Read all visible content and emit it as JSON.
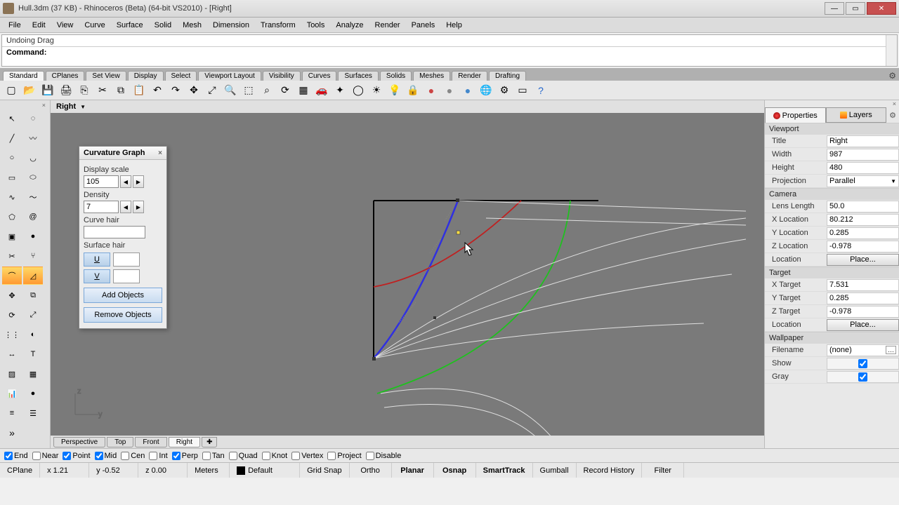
{
  "window": {
    "title": "Hull.3dm (37 KB) - Rhinoceros (Beta) (64-bit VS2010) - [Right]",
    "btn_min": "—",
    "btn_max": "▭",
    "btn_close": "✕"
  },
  "menu": [
    "File",
    "Edit",
    "View",
    "Curve",
    "Surface",
    "Solid",
    "Mesh",
    "Dimension",
    "Transform",
    "Tools",
    "Analyze",
    "Render",
    "Panels",
    "Help"
  ],
  "cmd": {
    "history": "Undoing Drag",
    "prompt": "Command:"
  },
  "toolbar_tabs": [
    "Standard",
    "CPlanes",
    "Set View",
    "Display",
    "Select",
    "Viewport Layout",
    "Visibility",
    "Curves",
    "Surfaces",
    "Solids",
    "Meshes",
    "Render",
    "Drafting"
  ],
  "std_icons": [
    "new",
    "open",
    "save",
    "print",
    "export",
    "cut",
    "copy",
    "paste",
    "undo",
    "redo",
    "pan",
    "zoom-ext",
    "zoom-win",
    "zoom-sel",
    "zoom-dyn",
    "rotate",
    "grid",
    "car",
    "bug",
    "circle",
    "sun",
    "light",
    "lock",
    "shade-r",
    "shade-g",
    "shade-b",
    "globe",
    "gear",
    "sel",
    "help"
  ],
  "left_tools": [
    "pointer",
    "lasso",
    "line",
    "polyline",
    "circle",
    "arc",
    "rect",
    "ellipse",
    "curve",
    "interp",
    "polygon",
    "spiral",
    "box",
    "sphere",
    "trim",
    "split",
    "fillet",
    "chamfer",
    "move",
    "copy",
    "rotate",
    "scale",
    "array",
    "boolean",
    "dim",
    "text",
    "hatch",
    "mesh",
    "analyze",
    "render",
    "layers",
    "props"
  ],
  "viewport": {
    "name": "Right",
    "axes": {
      "v": "z",
      "h": "y"
    }
  },
  "view_tabs": [
    "Perspective",
    "Top",
    "Front",
    "Right"
  ],
  "curvature_panel": {
    "title": "Curvature Graph",
    "display_scale_label": "Display scale",
    "display_scale": "105",
    "density_label": "Density",
    "density": "7",
    "curve_hair_label": "Curve hair",
    "surface_hair_label": "Surface hair",
    "u_label": "U",
    "v_label": "V",
    "add": "Add Objects",
    "remove": "Remove Objects"
  },
  "properties": {
    "tab_props": "Properties",
    "tab_layers": "Layers",
    "sections": {
      "viewport": "Viewport",
      "camera": "Camera",
      "target": "Target",
      "wallpaper": "Wallpaper"
    },
    "viewport": {
      "title_k": "Title",
      "title_v": "Right",
      "width_k": "Width",
      "width_v": "987",
      "height_k": "Height",
      "height_v": "480",
      "proj_k": "Projection",
      "proj_v": "Parallel"
    },
    "camera": {
      "lens_k": "Lens Length",
      "lens_v": "50.0",
      "xloc_k": "X Location",
      "xloc_v": "80.212",
      "yloc_k": "Y Location",
      "yloc_v": "0.285",
      "zloc_k": "Z Location",
      "zloc_v": "-0.978",
      "loc_k": "Location",
      "place": "Place..."
    },
    "target": {
      "xt_k": "X Target",
      "xt_v": "7.531",
      "yt_k": "Y Target",
      "yt_v": "0.285",
      "zt_k": "Z Target",
      "zt_v": "-0.978",
      "loc_k": "Location",
      "place": "Place..."
    },
    "wallpaper": {
      "file_k": "Filename",
      "file_v": "(none)",
      "show_k": "Show",
      "gray_k": "Gray"
    }
  },
  "osnap": {
    "items": [
      {
        "label": "End",
        "checked": true
      },
      {
        "label": "Near",
        "checked": false
      },
      {
        "label": "Point",
        "checked": true
      },
      {
        "label": "Mid",
        "checked": true
      },
      {
        "label": "Cen",
        "checked": false
      },
      {
        "label": "Int",
        "checked": false
      },
      {
        "label": "Perp",
        "checked": true
      },
      {
        "label": "Tan",
        "checked": false
      },
      {
        "label": "Quad",
        "checked": false
      },
      {
        "label": "Knot",
        "checked": false
      },
      {
        "label": "Vertex",
        "checked": false
      },
      {
        "label": "Project",
        "checked": false
      },
      {
        "label": "Disable",
        "checked": false
      }
    ]
  },
  "status": {
    "cplane": "CPlane",
    "x": "x 1.21",
    "y": "y -0.52",
    "z": "z 0.00",
    "units": "Meters",
    "layer": "Default",
    "toggles": [
      "Grid Snap",
      "Ortho",
      "Planar",
      "Osnap",
      "SmartTrack",
      "Gumball",
      "Record History",
      "Filter"
    ],
    "bold": {
      "Planar": true,
      "Osnap": true,
      "SmartTrack": true
    }
  }
}
